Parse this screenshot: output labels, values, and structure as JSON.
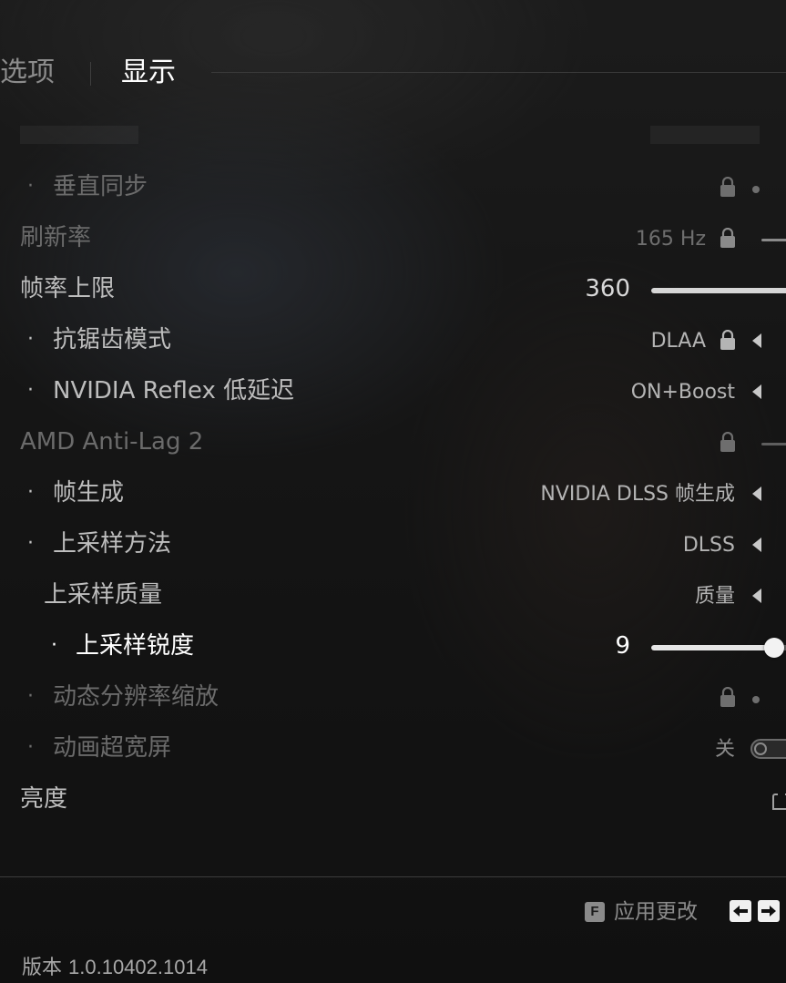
{
  "tabs": {
    "options": "选项",
    "display": "显示"
  },
  "rows": [
    {
      "label": "垂直同步"
    },
    {
      "label": "刷新率",
      "value": "165 Hz"
    },
    {
      "label": "帧率上限",
      "value": "360",
      "slider_level": 1.0
    },
    {
      "label": "抗锯齿模式",
      "value": "DLAA"
    },
    {
      "label": "NVIDIA Reflex 低延迟",
      "value": "ON+Boost"
    },
    {
      "label": "AMD Anti-Lag 2"
    },
    {
      "label": "帧生成",
      "value": "NVIDIA DLSS 帧生成"
    },
    {
      "label": "上采样方法",
      "value": "DLSS"
    },
    {
      "label": "上采样质量",
      "value": "质量"
    },
    {
      "label": "上采样锐度",
      "value": "9",
      "slider_level": 0.9
    },
    {
      "label": "动态分辨率缩放"
    },
    {
      "label": "动画超宽屏",
      "value": "关"
    },
    {
      "label": "亮度"
    }
  ],
  "bullet": "·",
  "footer": {
    "apply_key": "F",
    "apply_label": "应用更改",
    "version_label": "版本",
    "version_number": "1.0.10402.1014"
  },
  "icons": {
    "lock": "lock-icon",
    "arrow": "arrow-left-icon",
    "prev": "arrow-left-key-icon",
    "next": "arrow-right-key-icon"
  }
}
